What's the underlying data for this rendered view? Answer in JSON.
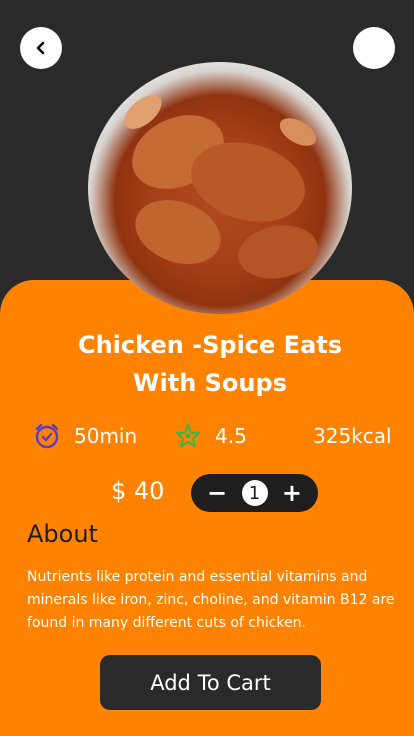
{
  "product": {
    "title": "Chicken -Spice Eats With Soups",
    "time": "50min",
    "rating": "4.5",
    "calories": "325kcal",
    "price": "$ 40",
    "quantity": "1"
  },
  "stepper": {
    "minus": "−",
    "plus": "+"
  },
  "about": {
    "heading": "About",
    "text": "Nutrients like protein and essential vitamins and minerals like iron, zinc, choline, and vitamin B12 are found in many different cuts of chicken."
  },
  "actions": {
    "add_to_cart": "Add To Cart"
  },
  "colors": {
    "accent": "#ff8200",
    "dark": "#2a2a2a",
    "alarm": "#5b3cc4",
    "star": "#3bb44a"
  }
}
